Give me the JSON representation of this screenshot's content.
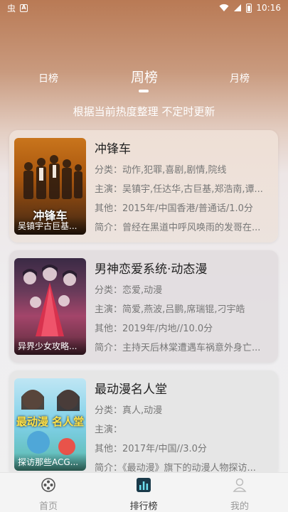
{
  "status_bar": {
    "time": "10:16",
    "left_glyph": "虫",
    "left_box": "A"
  },
  "tabs": [
    {
      "label": "日榜",
      "active": false
    },
    {
      "label": "周榜",
      "active": true
    },
    {
      "label": "月榜",
      "active": false
    }
  ],
  "subtitle": "根据当前热度整理 不定时更新",
  "cards": [
    {
      "title": "冲锋车",
      "poster_art": "冲锋车",
      "poster_caption": "吴镇宇古巨基...",
      "genre": "分类：动作,犯罪,喜剧,剧情,院线",
      "cast": "主演：吴镇宇,任达华,古巨基,郑浩南,谭...",
      "other": "其他：2015年/中国香港/普通话/1.0分",
      "synopsis": "简介：曾经在黑道中呼风唤雨的发哥在..."
    },
    {
      "title": "男神恋爱系统·动态漫",
      "poster_caption": "异界少女攻略...",
      "genre": "分类：恋爱,动漫",
      "cast": "主演：简爱,燕波,吕鹏,席瑞锟,刁宇皓",
      "other": "其他：2019年/内地//10.0分",
      "synopsis": "简介：主持天后林棠遭遇车祸意外身亡..."
    },
    {
      "title": "最动漫名人堂",
      "poster_art": "最动漫 名人堂",
      "poster_caption": "探访那些ACG...",
      "genre": "分类：真人,动漫",
      "cast": "主演：",
      "other": "其他：2017年/中国//3.0分",
      "synopsis": "简介：《最动漫》旗下的动漫人物探访..."
    }
  ],
  "bottom_nav": [
    {
      "label": "首页",
      "icon": "film-reel-icon",
      "active": false
    },
    {
      "label": "排行榜",
      "icon": "chart-icon",
      "active": true
    },
    {
      "label": "我的",
      "icon": "profile-icon",
      "active": false
    }
  ]
}
